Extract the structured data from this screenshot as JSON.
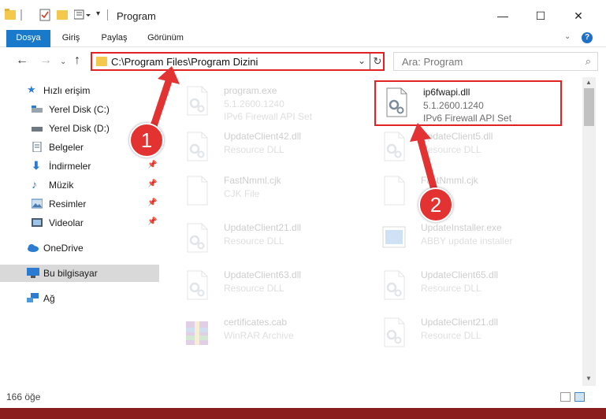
{
  "window": {
    "title": "Program"
  },
  "ribbon": {
    "tabs": [
      {
        "label": "Dosya",
        "active": true
      },
      {
        "label": "Giriş"
      },
      {
        "label": "Paylaş"
      },
      {
        "label": "Görünüm"
      }
    ],
    "help_label": "?"
  },
  "nav": {
    "address": "C:\\Program Files\\Program Dizini",
    "search_placeholder": "Ara: Program"
  },
  "sidebar": {
    "items": [
      {
        "label": "Hızlı erişim",
        "icon": "star-icon"
      },
      {
        "label": "Yerel Disk (C:)",
        "icon": "drive-icon"
      },
      {
        "label": "Yerel Disk (D:)",
        "icon": "drive-icon"
      },
      {
        "label": "Belgeler",
        "icon": "documents-icon",
        "pinned": true
      },
      {
        "label": "İndirmeler",
        "icon": "download-icon",
        "pinned": true
      },
      {
        "label": "Müzik",
        "icon": "music-icon",
        "pinned": true
      },
      {
        "label": "Resimler",
        "icon": "pictures-icon",
        "pinned": true
      },
      {
        "label": "Videolar",
        "icon": "videos-icon",
        "pinned": true
      },
      {
        "label": "OneDrive",
        "icon": "cloud-icon"
      },
      {
        "label": "Bu bilgisayar",
        "icon": "computer-icon",
        "selected": true
      },
      {
        "label": "Ağ",
        "icon": "network-icon"
      }
    ]
  },
  "files": [
    {
      "name": "program.exe",
      "line2": "5.1.2600.1240",
      "line3": "IPv6 Firewall API Set",
      "faded": true,
      "icon": "exe-icon"
    },
    {
      "name": "ip6fwapi.dll",
      "line2": "5.1.2600.1240",
      "line3": "IPv6 Firewall API Set",
      "highlighted": true,
      "icon": "dll-icon"
    },
    {
      "name": "UpdateClient42.dll",
      "line2": "Resource DLL",
      "faded": true,
      "icon": "dll-icon"
    },
    {
      "name": "UpdateClient5.dll",
      "line2": "Resource DLL",
      "faded": true,
      "icon": "dll-icon"
    },
    {
      "name": "FastNmml.cjk",
      "line2": "CJK File",
      "faded": true,
      "icon": "file-icon"
    },
    {
      "name": "FastNmml.cjk",
      "line2": "",
      "faded": true,
      "icon": "file-icon"
    },
    {
      "name": "UpdateClient21.dll",
      "line2": "Resource DLL",
      "faded": true,
      "icon": "dll-icon"
    },
    {
      "name": "UpdateInstaller.exe",
      "line2": "ABBY update installer",
      "faded": true,
      "icon": "installer-icon"
    },
    {
      "name": "UpdateClient63.dll",
      "line2": "Resource DLL",
      "faded": true,
      "icon": "dll-icon"
    },
    {
      "name": "UpdateClient65.dll",
      "line2": "Resource DLL",
      "faded": true,
      "icon": "dll-icon"
    },
    {
      "name": "certificates.cab",
      "line2": "WinRAR Archive",
      "faded": true,
      "icon": "archive-icon"
    },
    {
      "name": "UpdateClient21.dll",
      "line2": "Resource DLL",
      "faded": true,
      "icon": "dll-icon"
    }
  ],
  "status": {
    "item_count": "166 öğe"
  },
  "annotations": [
    {
      "label": "1",
      "target": "address bar"
    },
    {
      "label": "2",
      "target": "ip6fwapi.dll"
    }
  ],
  "colors": {
    "accent": "#1979ca",
    "highlight": "#e02222",
    "folder": "#f3c84c"
  }
}
